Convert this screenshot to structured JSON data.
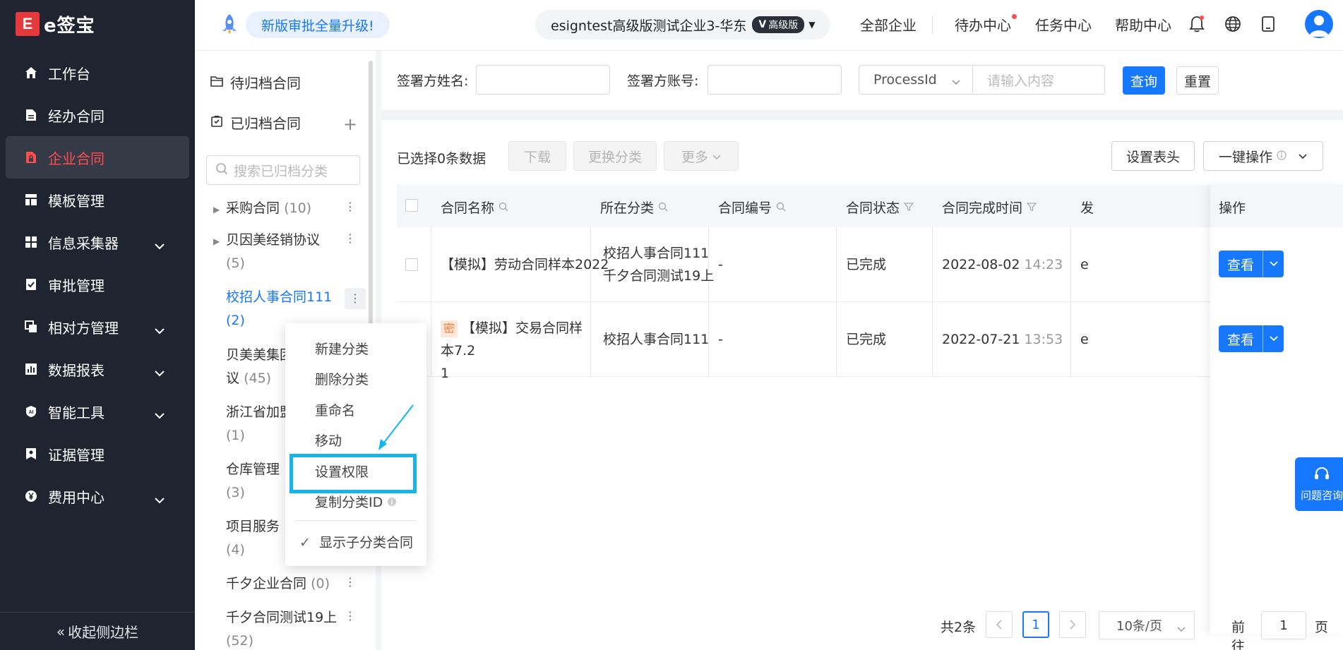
{
  "brand": {
    "logo_mark": "E",
    "logo_text": "e签宝"
  },
  "sidebar": {
    "items": [
      {
        "label": "工作台",
        "icon": "home-icon",
        "expandable": false,
        "active": false
      },
      {
        "label": "经办合同",
        "icon": "document-icon",
        "expandable": false,
        "active": false
      },
      {
        "label": "企业合同",
        "icon": "lock-document-icon",
        "expandable": false,
        "active": true
      },
      {
        "label": "模板管理",
        "icon": "template-icon",
        "expandable": false,
        "active": false
      },
      {
        "label": "信息采集器",
        "icon": "grid-icon",
        "expandable": true,
        "active": false
      },
      {
        "label": "审批管理",
        "icon": "approval-icon",
        "expandable": false,
        "active": false
      },
      {
        "label": "相对方管理",
        "icon": "copy-icon",
        "expandable": true,
        "active": false
      },
      {
        "label": "数据报表",
        "icon": "chart-icon",
        "expandable": true,
        "active": false
      },
      {
        "label": "智能工具",
        "icon": "ai-icon",
        "expandable": true,
        "active": false
      },
      {
        "label": "证据管理",
        "icon": "evidence-icon",
        "expandable": false,
        "active": false
      },
      {
        "label": "费用中心",
        "icon": "yen-icon",
        "expandable": true,
        "active": false
      }
    ],
    "collapse_label": "收起侧边栏",
    "active_color": "#ff4d4f"
  },
  "header": {
    "upgrade_text": "新版审批全量升级!",
    "company_name": "esigntest高级版测试企业3-华东",
    "company_badge": "高级版",
    "nav": [
      "全部企业",
      "待办中心",
      "任务中心",
      "帮助中心"
    ],
    "icons": [
      "bell-icon",
      "globe-icon",
      "tablet-icon",
      "user-avatar-icon"
    ]
  },
  "categories": {
    "pending_label": "待归档合同",
    "archived_label": "已归档合同",
    "search_placeholder": "搜索已归档分类",
    "nodes": [
      {
        "name": "采购合同",
        "count": "(10)"
      },
      {
        "name": "贝因美经销协议",
        "count": "(5)"
      },
      {
        "name": "校招人事合同111",
        "count": "(2)"
      },
      {
        "name": "贝美美集团",
        "line2": "议",
        "count": "(45)"
      },
      {
        "name": "浙江省加盟",
        "count": "(1)"
      },
      {
        "name": "仓库管理",
        "count": "(3)"
      },
      {
        "name": "项目服务",
        "count": "(4)"
      },
      {
        "name": "千夕企业合同",
        "count": "(0)"
      },
      {
        "name": "千夕合同测试19上",
        "count": "(52)"
      }
    ]
  },
  "context_menu": {
    "items": [
      "新建分类",
      "删除分类",
      "重命名",
      "移动",
      "设置权限",
      "复制分类ID"
    ],
    "toggle_label": "显示子分类合同",
    "highlight_color": "#13b5ea"
  },
  "filter": {
    "signer_name_label": "签署方姓名:",
    "signer_account_label": "签署方账号:",
    "select_value": "ProcessId",
    "input_placeholder": "请输入内容",
    "query_label": "查询",
    "reset_label": "重置"
  },
  "toolbar": {
    "selected_text": "已选择0条数据",
    "download_label": "下载",
    "change_category_label": "更换分类",
    "more_label": "更多",
    "set_header_label": "设置表头",
    "bulk_label": "一键操作"
  },
  "table": {
    "columns": [
      "合同名称",
      "所在分类",
      "合同编号",
      "合同状态",
      "合同完成时间",
      "发",
      "操作"
    ],
    "rows": [
      {
        "secret": "",
        "name": "【模拟】劳动合同样本2022",
        "name2": "",
        "category": "校招人事合同111",
        "category2": "千夕合同测试19上",
        "number": "-",
        "status": "已完成",
        "date": "2022-08-02",
        "time": "14:23",
        "initiator": "e",
        "action": "查看"
      },
      {
        "secret": "密",
        "name": "【模拟】交易合同样本7.2",
        "name2": "1",
        "category": "校招人事合同111",
        "category2": "",
        "number": "-",
        "status": "已完成",
        "date": "2022-07-21",
        "time": "13:53",
        "initiator": "e",
        "action": "查看"
      }
    ]
  },
  "help_float_label": "问题咨询",
  "pagination": {
    "total_text": "共2条",
    "current_page": "1",
    "page_size": "10条/页",
    "goto_label": "前往",
    "goto_value": "1",
    "goto_suffix": "页"
  },
  "colors": {
    "primary": "#1677ff",
    "sidebar_bg": "#1f2430",
    "danger": "#ff4d4f"
  }
}
